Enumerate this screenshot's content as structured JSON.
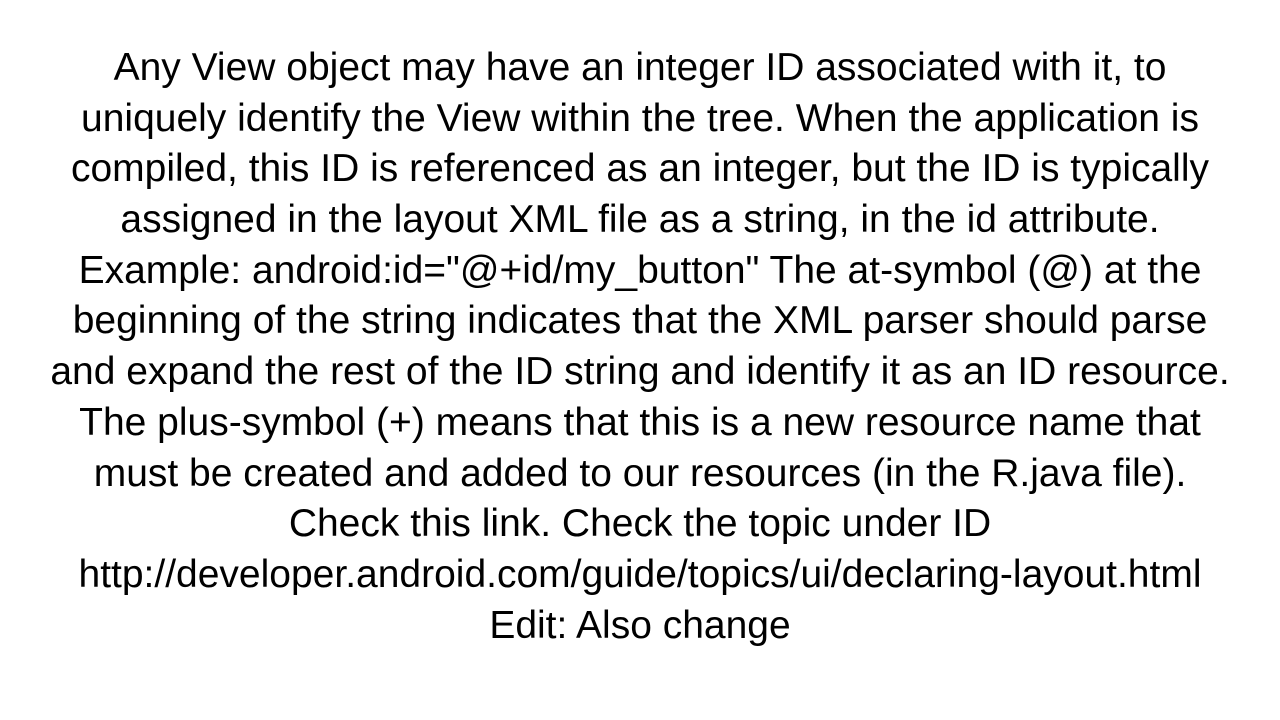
{
  "document": {
    "body_text": "Any View object may have an integer ID associated with it, to uniquely identify the View within the tree. When the application is compiled, this ID is referenced as an integer, but the ID is typically assigned in the layout XML file as a string, in the id attribute. Example: android:id=\"@+id/my_button\"  The at-symbol (@) at the beginning of the string indicates that the XML parser should parse and expand the rest of the ID string and identify it as an ID resource. The plus-symbol (+) means that this is a new resource name that must be created and added to our resources (in the R.java file). Check this link. Check the topic under ID http://developer.android.com/guide/topics/ui/declaring-layout.html Edit: Also change"
  }
}
